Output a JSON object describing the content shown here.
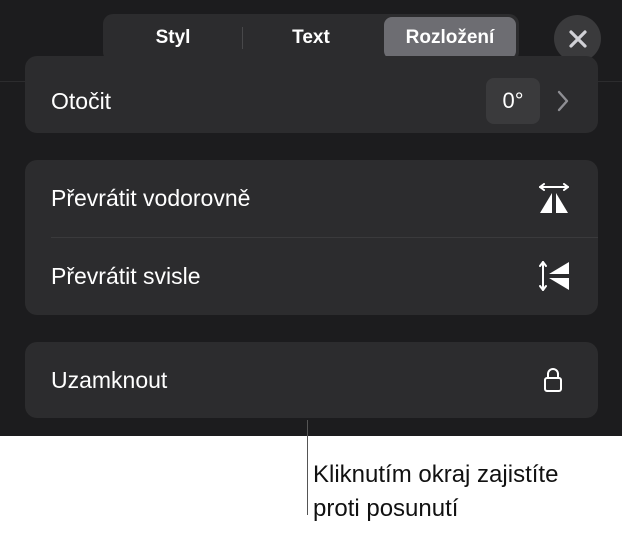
{
  "tabs": [
    {
      "label": "Styl",
      "selected": false
    },
    {
      "label": "Text",
      "selected": false
    },
    {
      "label": "Rozložení",
      "selected": true
    }
  ],
  "close_icon": "close-icon",
  "rotate": {
    "label": "Otočit",
    "value": "0°",
    "icon": "chevron-right-icon"
  },
  "flip": {
    "horizontal": {
      "label": "Převrátit vodorovně",
      "icon": "flip-horizontal-icon"
    },
    "vertical": {
      "label": "Převrátit svisle",
      "icon": "flip-vertical-icon"
    }
  },
  "lock": {
    "label": "Uzamknout",
    "icon": "lock-icon"
  },
  "callout": {
    "text": "Kliknutím okraj zajistíte\nproti posunutí"
  },
  "colors": {
    "panel_bg": "#1c1c1e",
    "group_bg": "#2c2c2e",
    "selected_tab": "#6d6d72"
  }
}
